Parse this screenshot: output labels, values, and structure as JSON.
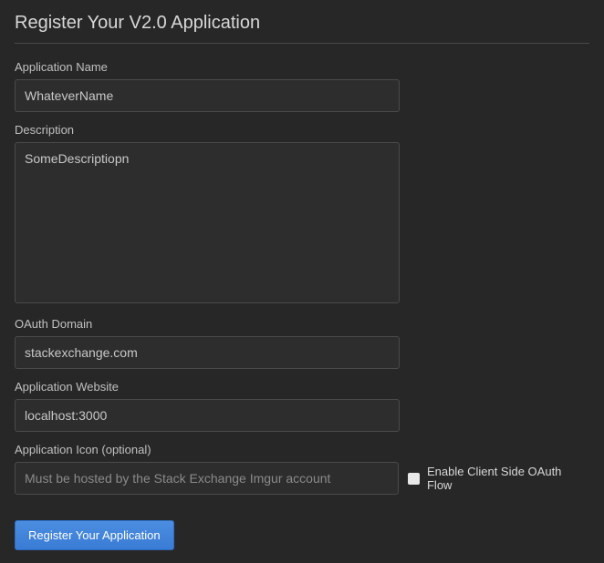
{
  "title": "Register Your V2.0 Application",
  "fields": {
    "app_name": {
      "label": "Application Name",
      "value": "WhateverName"
    },
    "description": {
      "label": "Description",
      "value": "SomeDescriptiopn"
    },
    "oauth_domain": {
      "label": "OAuth Domain",
      "value": "stackexchange.com"
    },
    "app_website": {
      "label": "Application Website",
      "value": "localhost:3000"
    },
    "app_icon": {
      "label": "Application Icon (optional)",
      "placeholder": "Must be hosted by the Stack Exchange Imgur account",
      "value": ""
    }
  },
  "checkbox": {
    "enable_client_oauth": "Enable Client Side OAuth Flow"
  },
  "submit_label": "Register Your Application"
}
